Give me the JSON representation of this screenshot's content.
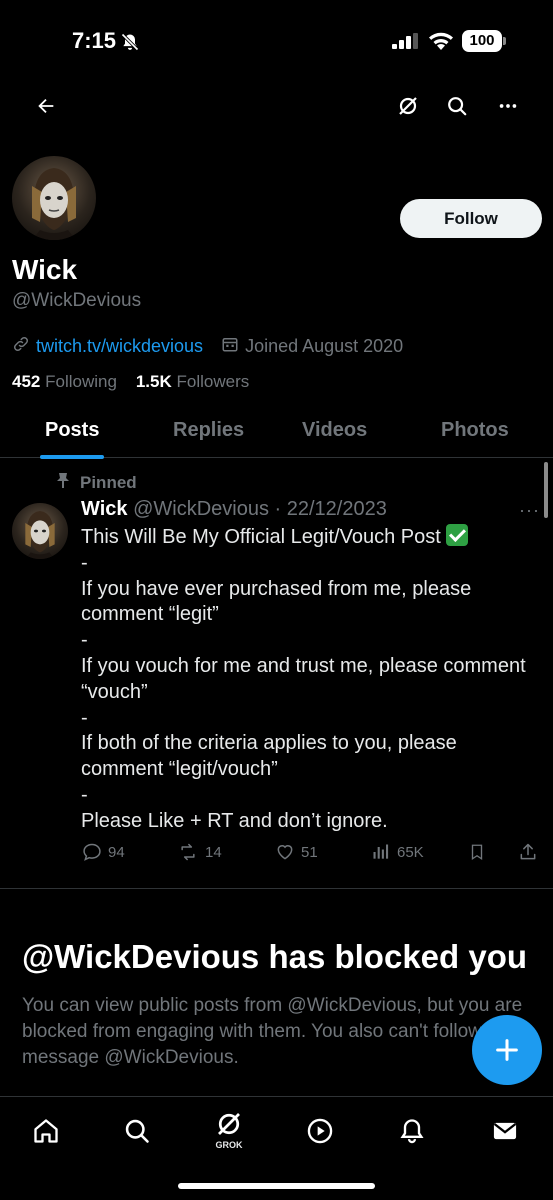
{
  "status": {
    "time": "7:15",
    "battery": "100"
  },
  "profile": {
    "display_name": "Wick",
    "handle": "@WickDevious",
    "link": "twitch.tv/wickdevious",
    "joined": "Joined August 2020",
    "following_count": "452",
    "following_label": "Following",
    "followers_count": "1.5K",
    "followers_label": "Followers",
    "follow_label": "Follow"
  },
  "tabs": [
    {
      "label": "Posts"
    },
    {
      "label": "Replies"
    },
    {
      "label": "Videos"
    },
    {
      "label": "Photos"
    }
  ],
  "post": {
    "pinned_label": "Pinned",
    "author": "Wick",
    "handle_date": "@WickDevious · 22/12/2023",
    "line1": "This Will Be My Official Legit/Vouch Post",
    "dash": "-",
    "line2": "If you have ever purchased from me, please comment “legit”",
    "line3": "If you vouch for me and trust me, please comment “vouch”",
    "line4": "If both of the criteria applies to you, please comment “legit/vouch”",
    "line5": "Please Like  + RT and don’t ignore.",
    "replies": "94",
    "reposts": "14",
    "likes": "51",
    "views": "65K"
  },
  "blocked": {
    "title": "@WickDevious has blocked you",
    "text": "You can view public posts from @WickDevious, but you are blocked from engaging with them. You also can't follow or message @WickDevious."
  },
  "bottom_nav": {
    "grok_label": "GROK"
  },
  "colors": {
    "accent": "#1d9bf0",
    "muted": "#71767b",
    "background": "#000000"
  }
}
